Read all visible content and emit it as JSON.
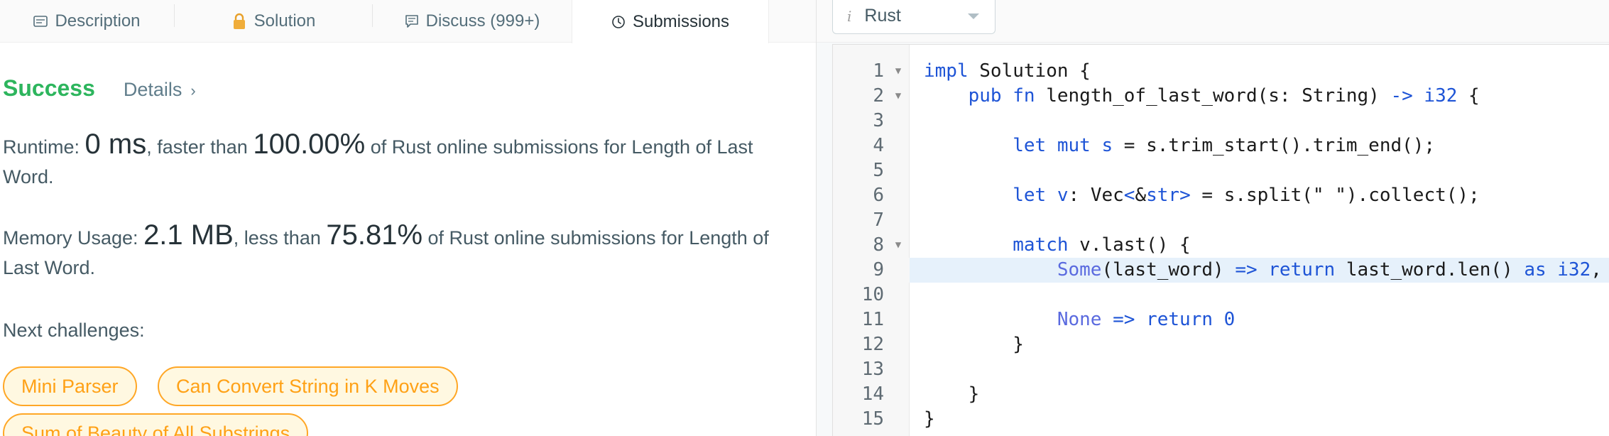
{
  "tabs": [
    {
      "label": "Description",
      "icon": "description-icon"
    },
    {
      "label": "Solution",
      "icon": "lock-icon"
    },
    {
      "label": "Discuss (999+)",
      "icon": "discuss-icon"
    },
    {
      "label": "Submissions",
      "icon": "clock-icon"
    }
  ],
  "result": {
    "status": "Success",
    "details_label": "Details",
    "details_chevron": "›"
  },
  "runtime": {
    "label": "Runtime: ",
    "value": "0 ms",
    "mid": ", faster than ",
    "percent": "100.00%",
    "suffix": " of Rust online submissions for Length of Last Word."
  },
  "memory": {
    "label": "Memory Usage: ",
    "value": "2.1 MB",
    "mid": ", less than ",
    "percent": "75.81%",
    "suffix": " of Rust online submissions for Length of Last Word."
  },
  "next": {
    "label": "Next challenges:",
    "chips": [
      "Mini Parser",
      "Can Convert String in K Moves",
      "Sum of Beauty of All Substrings"
    ]
  },
  "editor": {
    "language": "Rust",
    "language_info_glyph": "i",
    "highlighted_line": 9,
    "lines": [
      {
        "n": "1",
        "fold": true
      },
      {
        "n": "2",
        "fold": true
      },
      {
        "n": "3",
        "fold": false
      },
      {
        "n": "4",
        "fold": false
      },
      {
        "n": "5",
        "fold": false
      },
      {
        "n": "6",
        "fold": false
      },
      {
        "n": "7",
        "fold": false
      },
      {
        "n": "8",
        "fold": true
      },
      {
        "n": "9",
        "fold": false
      },
      {
        "n": "10",
        "fold": false
      },
      {
        "n": "11",
        "fold": false
      },
      {
        "n": "12",
        "fold": false
      },
      {
        "n": "13",
        "fold": false
      },
      {
        "n": "14",
        "fold": false
      },
      {
        "n": "15",
        "fold": false
      }
    ],
    "code": {
      "l1_kw": "impl",
      "l1_rest": " Solution {",
      "l2_indent": "    ",
      "l2_kw1": "pub fn",
      "l2_rest1": " length_of_last_word(s: String) ",
      "l2_arrow": "->",
      "l2_space": " ",
      "l2_type": "i32",
      "l2_rest2": " {",
      "l4_indent": "        ",
      "l4_kw": "let mut",
      "l4_sp": " ",
      "l4_var": "s",
      "l4_eq": " = ",
      "l4_rest": "s.trim_start().trim_end();",
      "l6_indent": "        ",
      "l6_kw": "let",
      "l6_sp": " ",
      "l6_var": "v",
      "l6_colon": ": Vec",
      "l6_lt": "<",
      "l6_amp": "&",
      "l6_str": "str",
      "l6_gt": ">",
      "l6_eq": " = ",
      "l6_rest": "s.split(\" \").collect();",
      "l8_indent": "        ",
      "l8_kw": "match",
      "l8_rest": " v.last() {",
      "l9_indent": "            ",
      "l9_some": "Some",
      "l9_mid": "(last_word) ",
      "l9_arrow": "=>",
      "l9_sp": " ",
      "l9_ret": "return",
      "l9_rest": " last_word.len() ",
      "l9_as": "as",
      "l9_sp2": " ",
      "l9_type": "i32",
      "l9_end": ",",
      "l11_indent": "            ",
      "l11_none": "None",
      "l11_sp": " ",
      "l11_arrow": "=>",
      "l11_sp2": " ",
      "l11_ret": "return",
      "l11_sp3": " ",
      "l11_num": "0",
      "l12_text": "        }",
      "l14_text": "    }",
      "l15_text": "}"
    }
  }
}
